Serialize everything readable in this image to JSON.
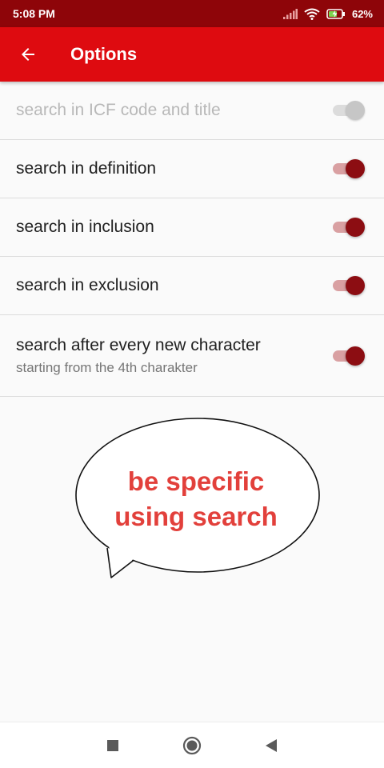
{
  "status_bar": {
    "time": "5:08 PM",
    "battery": "62%"
  },
  "app_bar": {
    "title": "Options"
  },
  "settings": [
    {
      "title": "search in ICF code and title",
      "subtitle": "",
      "enabled": false,
      "checked": false
    },
    {
      "title": "search in definition",
      "subtitle": "",
      "enabled": true,
      "checked": true
    },
    {
      "title": "search in inclusion",
      "subtitle": "",
      "enabled": true,
      "checked": true
    },
    {
      "title": "search in exclusion",
      "subtitle": "",
      "enabled": true,
      "checked": true
    },
    {
      "title": "search after every new character",
      "subtitle": "starting from the 4th charakter",
      "enabled": true,
      "checked": true
    }
  ],
  "bubble": {
    "line1": "be specific",
    "line2": "using search"
  },
  "colors": {
    "status_bar": "#8e0509",
    "app_bar": "#de0b10",
    "switch_on": "#8c0d12",
    "bubble_text": "#e2403b"
  },
  "icons": {
    "back": "arrow-left-icon",
    "signal": "signal-icon",
    "wifi": "wifi-icon",
    "battery": "battery-charging-icon",
    "nav_recent": "square-icon",
    "nav_home": "circle-icon",
    "nav_back": "triangle-back-icon"
  }
}
